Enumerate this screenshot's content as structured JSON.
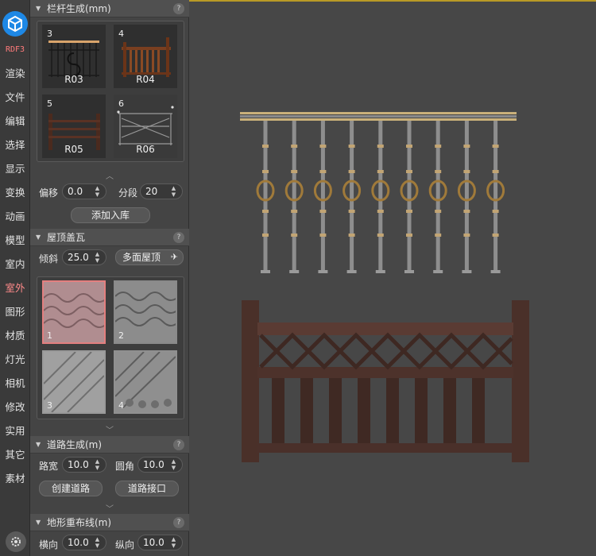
{
  "brand": "RDF3",
  "nav": [
    "渲染",
    "文件",
    "编辑",
    "选择",
    "显示",
    "变换",
    "动画",
    "模型",
    "室内",
    "室外",
    "图形",
    "材质",
    "灯光",
    "相机",
    "修改",
    "实用",
    "其它",
    "素材"
  ],
  "nav_active": "室外",
  "railing": {
    "title": "栏杆生成(mm)",
    "items": [
      {
        "num": "3",
        "name": "R03"
      },
      {
        "num": "4",
        "name": "R04"
      },
      {
        "num": "5",
        "name": "R05"
      },
      {
        "num": "6",
        "name": "R06"
      }
    ],
    "offset_label": "偏移",
    "offset_value": "0.0",
    "segment_label": "分段",
    "segment_value": "20",
    "add_button": "添加入库"
  },
  "roof": {
    "title": "屋顶盖瓦",
    "slope_label": "倾斜",
    "slope_value": "25.0",
    "multi_button": "多面屋顶",
    "items": [
      "1",
      "2",
      "3",
      "4"
    ],
    "selected": "1"
  },
  "road": {
    "title": "道路生成(m)",
    "width_label": "路宽",
    "width_value": "10.0",
    "corner_label": "圆角",
    "corner_value": "10.0",
    "create_button": "创建道路",
    "connect_button": "道路接口"
  },
  "terrain": {
    "title": "地形重布线(m)",
    "h_label": "横向",
    "h_value": "10.0",
    "v_label": "纵向",
    "v_value": "10.0"
  },
  "help_symbol": "?",
  "colors": {
    "accent": "#1e88e5",
    "selected_border": "#e37f7f",
    "viewport_border": "#b99a26",
    "brand": "#ff7b7b"
  }
}
